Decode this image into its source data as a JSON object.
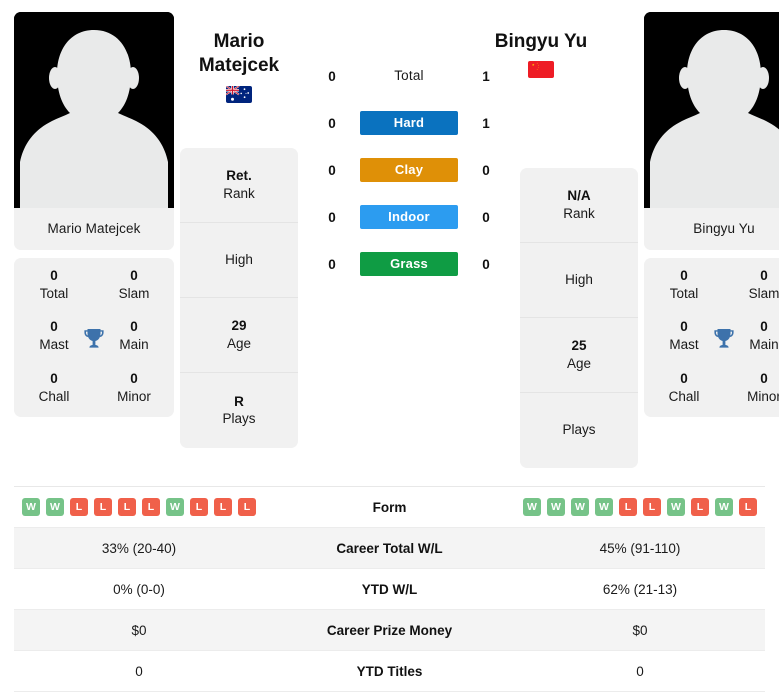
{
  "players": {
    "left": {
      "name_display": "Mario\nMatejcek",
      "name_line1": "Mario",
      "name_line2": "Matejcek",
      "photo_caption": "Mario Matejcek",
      "flag": "australia-flag",
      "flag_colors": {
        "field": "#00247d",
        "cross": "#ffffff",
        "star": "#ffffff"
      },
      "avatar": "player-silhouette-placeholder",
      "titles": [
        {
          "value": "0",
          "label": "Total"
        },
        {
          "value": "0",
          "label": "Slam"
        },
        {
          "value": "0",
          "label": "Mast"
        },
        {
          "value": "0",
          "label": "Main"
        },
        {
          "value": "0",
          "label": "Chall"
        },
        {
          "value": "0",
          "label": "Minor"
        }
      ],
      "info": [
        {
          "value": "Ret.",
          "label": "Rank"
        },
        {
          "value": "",
          "label": "High"
        },
        {
          "value": "29",
          "label": "Age"
        },
        {
          "value": "R",
          "label": "Plays"
        }
      ],
      "form": [
        "W",
        "W",
        "L",
        "L",
        "L",
        "L",
        "W",
        "L",
        "L",
        "L"
      ],
      "career_total_wl": "33% (20-40)",
      "ytd_wl": "0% (0-0)",
      "career_prize_money": "$0",
      "ytd_titles": "0"
    },
    "right": {
      "name_display": "Bingyu Yu",
      "name_line1": "Bingyu Yu",
      "name_line2": "",
      "photo_caption": "Bingyu Yu",
      "flag": "china-flag",
      "flag_colors": {
        "field": "#ee1c25",
        "star": "#ffde00"
      },
      "avatar": "player-silhouette-placeholder",
      "titles": [
        {
          "value": "0",
          "label": "Total"
        },
        {
          "value": "0",
          "label": "Slam"
        },
        {
          "value": "0",
          "label": "Mast"
        },
        {
          "value": "0",
          "label": "Main"
        },
        {
          "value": "0",
          "label": "Chall"
        },
        {
          "value": "0",
          "label": "Minor"
        }
      ],
      "info": [
        {
          "value": "N/A",
          "label": "Rank"
        },
        {
          "value": "",
          "label": "High"
        },
        {
          "value": "25",
          "label": "Age"
        },
        {
          "value": "",
          "label": "Plays"
        }
      ],
      "form": [
        "W",
        "W",
        "W",
        "W",
        "L",
        "L",
        "W",
        "L",
        "W",
        "L"
      ],
      "career_total_wl": "45% (91-110)",
      "ytd_wl": "62% (21-13)",
      "career_prize_money": "$0",
      "ytd_titles": "0"
    }
  },
  "surfaces": [
    {
      "label": "Total",
      "left": "0",
      "right": "1",
      "color": "transparent",
      "style": "plain"
    },
    {
      "label": "Hard",
      "left": "0",
      "right": "1",
      "color": "#0a72bf",
      "style": "badge"
    },
    {
      "label": "Clay",
      "left": "0",
      "right": "0",
      "color": "#df9007",
      "style": "badge"
    },
    {
      "label": "Indoor",
      "left": "0",
      "right": "0",
      "color": "#2c9cf0",
      "style": "badge"
    },
    {
      "label": "Grass",
      "left": "0",
      "right": "0",
      "color": "#0f9c44",
      "style": "badge"
    }
  ],
  "stats_rows": [
    {
      "label": "Form",
      "type": "form",
      "left": "",
      "right": ""
    },
    {
      "label": "Career Total W/L",
      "type": "text",
      "left": "33% (20-40)",
      "right": "45% (91-110)"
    },
    {
      "label": "YTD W/L",
      "type": "text",
      "left": "0% (0-0)",
      "right": "62% (21-13)"
    },
    {
      "label": "Career Prize Money",
      "type": "text",
      "left": "$0",
      "right": "$0"
    },
    {
      "label": "YTD Titles",
      "type": "text",
      "left": "0",
      "right": "0"
    }
  ],
  "icons": {
    "trophy": "trophy-icon",
    "trophy_color": "#3d72ab"
  },
  "theme": {
    "card_bg": "#f1f1f1",
    "row_alt_bg": "#f4f4f4",
    "win_color": "#76c388",
    "loss_color": "#f0604a",
    "text_color": "#111111"
  }
}
